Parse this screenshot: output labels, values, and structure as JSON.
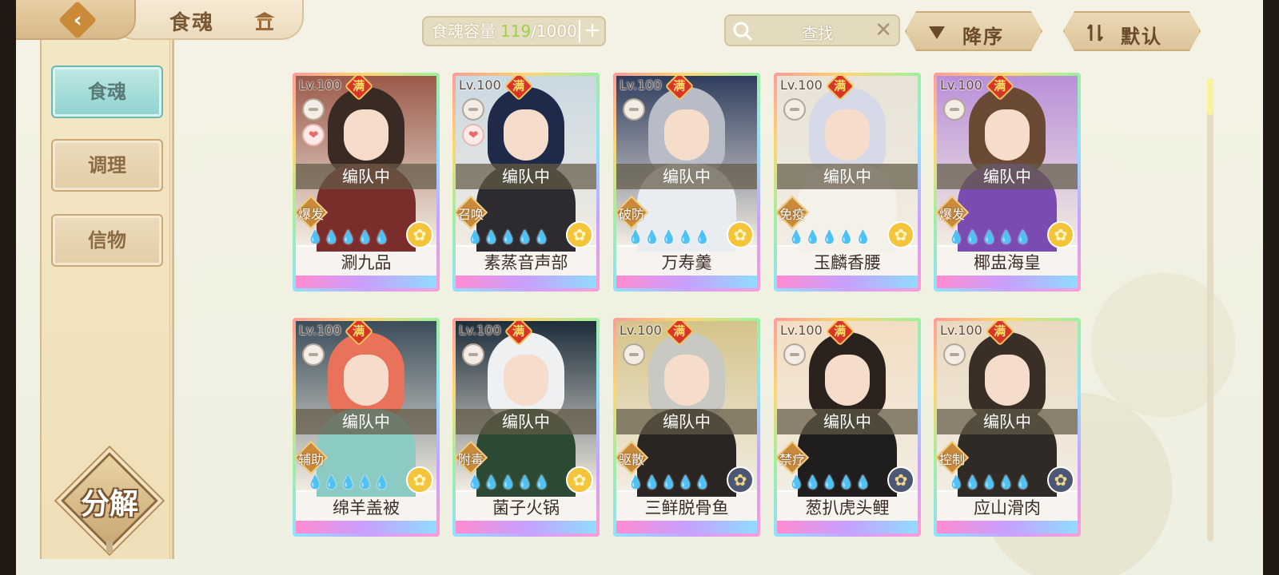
{
  "header": {
    "title": "食魂",
    "capacity": {
      "label": "食魂容量",
      "used": "119",
      "total": "/1000"
    },
    "search": {
      "placeholder": "查找"
    },
    "sort_desc_label": "降序",
    "sort_default_label": "默认"
  },
  "sidebar": {
    "tabs": [
      {
        "label": "食魂",
        "active": true
      },
      {
        "label": "调理",
        "active": false
      },
      {
        "label": "信物",
        "active": false
      }
    ],
    "decompose_label": "分解"
  },
  "cards": [
    {
      "level": "Lv.100",
      "max": "满",
      "status": "编队中",
      "role": "爆发",
      "name": "涮九品",
      "rarity": "gold",
      "fav": true,
      "hair": "#3a2a24",
      "body": "#7b2d2b",
      "bg": "#9b5a4a"
    },
    {
      "level": "Lv.100",
      "max": "满",
      "status": "编队中",
      "role": "召唤",
      "name": "素蒸音声部",
      "rarity": "gold",
      "fav": true,
      "hair": "#1f2a4a",
      "body": "#2d2b30",
      "bg": "#c9d8e2"
    },
    {
      "level": "Lv.100",
      "max": "满",
      "status": "编队中",
      "role": "破防",
      "name": "万寿羹",
      "rarity": "gold",
      "fav": false,
      "hair": "#b7bcc6",
      "body": "#e9ecf1",
      "bg": "#2f3d5e"
    },
    {
      "level": "Lv.100",
      "max": "满",
      "status": "编队中",
      "role": "免疫",
      "name": "玉麟香腰",
      "rarity": "gold",
      "fav": false,
      "hair": "#d6d9e8",
      "body": "#f4f1ea",
      "bg": "#e8e3d6"
    },
    {
      "level": "Lv.100",
      "max": "满",
      "status": "编队中",
      "role": "爆发",
      "name": "椰盅海皇",
      "rarity": "gold",
      "fav": false,
      "hair": "#6a4a34",
      "body": "#7a4bb0",
      "bg": "#b98fd8"
    },
    {
      "level": "Lv.100",
      "max": "满",
      "status": "编队中",
      "role": "辅助",
      "name": "绵羊盖被",
      "rarity": "gold",
      "fav": false,
      "hair": "#e8735a",
      "body": "#8ccbc4",
      "bg": "#3b4d5a"
    },
    {
      "level": "Lv.100",
      "max": "满",
      "status": "编队中",
      "role": "附毒",
      "name": "菌子火锅",
      "rarity": "gold",
      "fav": false,
      "hair": "#eef0f2",
      "body": "#2c4a33",
      "bg": "#1c2d3a"
    },
    {
      "level": "Lv.100",
      "max": "满",
      "status": "编队中",
      "role": "驱散",
      "name": "三鲜脱骨鱼",
      "rarity": "dark",
      "fav": false,
      "hair": "#c9c9c4",
      "body": "#2a2522",
      "bg": "#d4c48a"
    },
    {
      "level": "Lv.100",
      "max": "满",
      "status": "编队中",
      "role": "禁疗",
      "name": "葱扒虎头鲤",
      "rarity": "dark",
      "fav": false,
      "hair": "#2b221e",
      "body": "#1f1d1e",
      "bg": "#f2dec3"
    },
    {
      "level": "Lv.100",
      "max": "满",
      "status": "编队中",
      "role": "控制",
      "name": "应山滑肉",
      "rarity": "dark",
      "fav": false,
      "hair": "#3a2f26",
      "body": "#2f2a25",
      "bg": "#e9d9c0"
    }
  ],
  "flames": "💧💧💧💧💧",
  "icons": {
    "back": "back-arrow-icon",
    "home": "pavilion-icon",
    "search": "magnifier-icon",
    "clear": "close-icon",
    "sort_desc": "triangle-down-icon",
    "sort_default": "swap-icon"
  }
}
